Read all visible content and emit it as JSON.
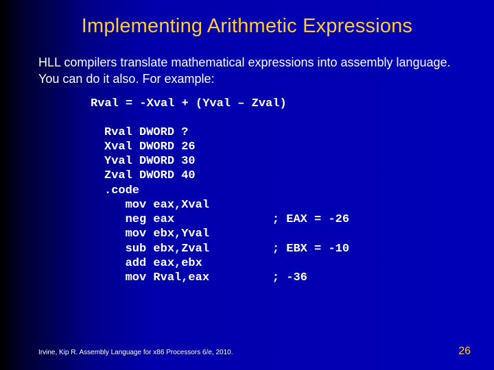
{
  "slide": {
    "title": "Implementing Arithmetic Expressions",
    "body": "HLL compilers translate mathematical expressions into assembly language. You can do it also. For example:",
    "expression": "Rval = -Xval + (Yval – Zval)",
    "code": "Rval DWORD ?\nXval DWORD 26\nYval DWORD 30\nZval DWORD 40\n.code\n   mov eax,Xval\n   neg eax              ; EAX = -26\n   mov ebx,Yval\n   sub ebx,Zval         ; EBX = -10\n   add eax,ebx\n   mov Rval,eax         ; -36",
    "footer": "Irvine, Kip R. Assembly Language for x86 Processors 6/e, 2010.",
    "page": "26"
  }
}
